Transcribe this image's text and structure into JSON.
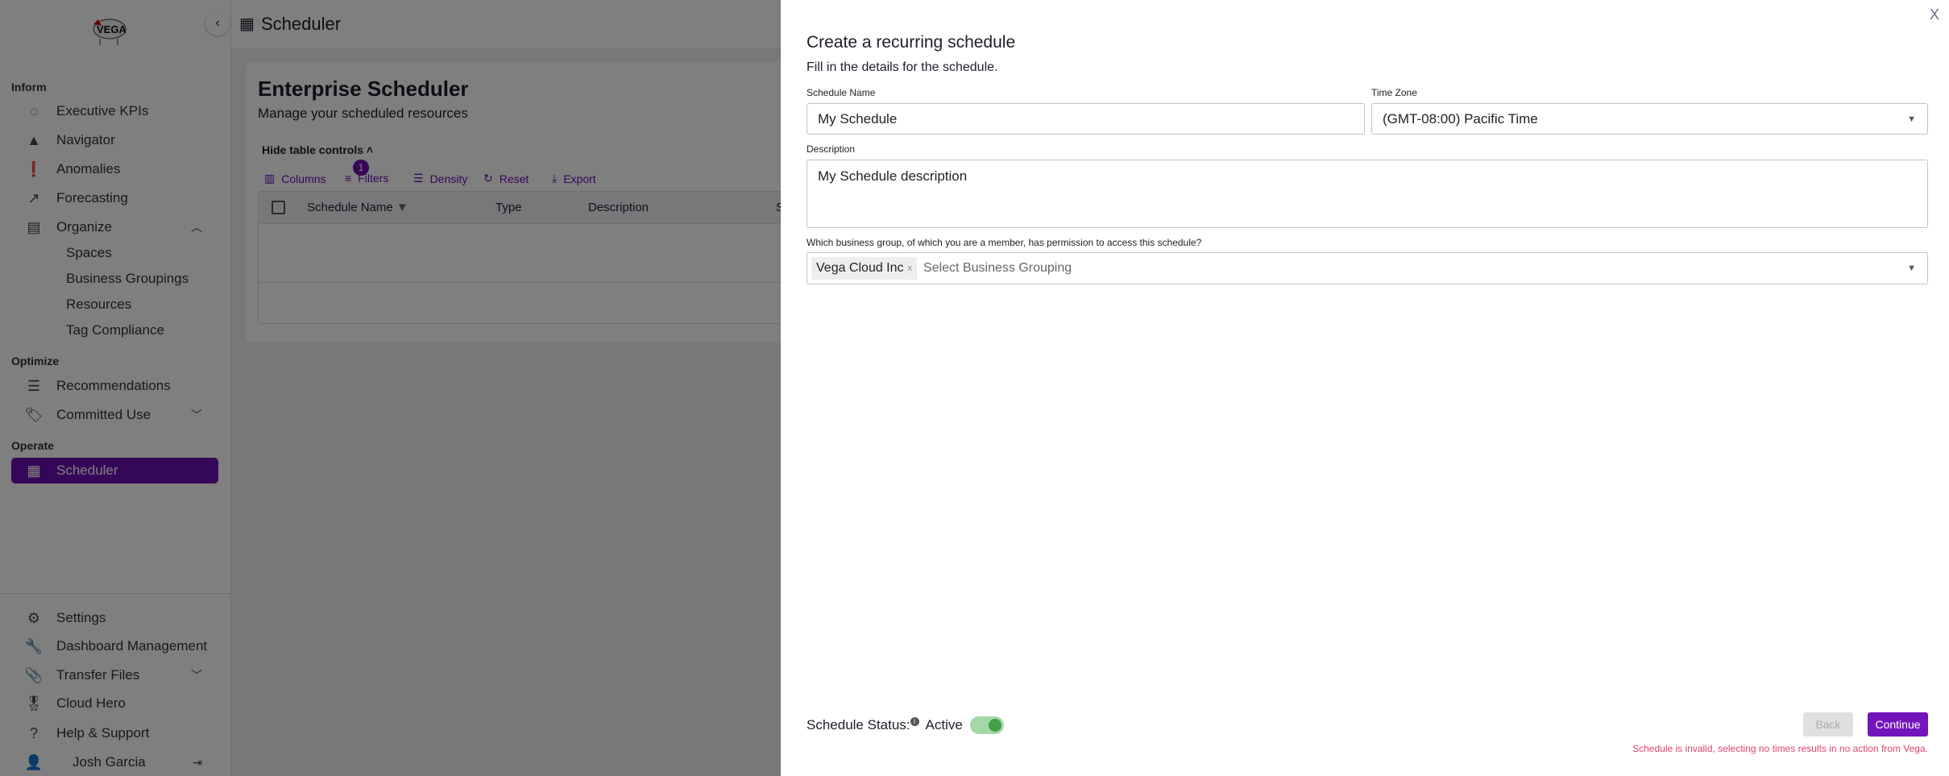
{
  "sidebar": {
    "sections": {
      "inform": "Inform",
      "optimize": "Optimize",
      "operate": "Operate"
    },
    "items": [
      {
        "label": "Executive KPIs",
        "icon": "circle-progress-icon"
      },
      {
        "label": "Navigator",
        "icon": "navigation-arrow-icon"
      },
      {
        "label": "Anomalies",
        "icon": "alert-circle-icon"
      },
      {
        "label": "Forecasting",
        "icon": "trending-up-icon"
      },
      {
        "label": "Organize",
        "icon": "archive-icon"
      }
    ],
    "organize_sub": [
      "Spaces",
      "Business Groupings",
      "Resources",
      "Tag Compliance"
    ],
    "optimize_items": [
      {
        "label": "Recommendations",
        "icon": "list-icon"
      },
      {
        "label": "Committed Use",
        "icon": "tag-icon"
      }
    ],
    "operate_items": [
      {
        "label": "Scheduler",
        "icon": "calendar-icon",
        "active": true
      }
    ],
    "bottom_items": [
      {
        "label": "Settings",
        "icon": "gear-icon"
      },
      {
        "label": "Dashboard Management",
        "icon": "wrench-icon"
      },
      {
        "label": "Transfer Files",
        "icon": "paperclip-file-icon"
      },
      {
        "label": "Cloud Hero",
        "icon": "medal-icon"
      },
      {
        "label": "Help & Support",
        "icon": "help-icon"
      }
    ],
    "user": "Josh Garcia"
  },
  "header": {
    "title": "Scheduler"
  },
  "page": {
    "title": "Enterprise Scheduler",
    "subtitle": "Manage your scheduled resources",
    "hide_controls": "Hide table controls",
    "toolbar": {
      "columns": "Columns",
      "filters": "Filters",
      "filter_count": "1",
      "density": "Density",
      "reset": "Reset",
      "export": "Export"
    },
    "columns": [
      "Schedule Name",
      "Type",
      "Description",
      "S"
    ]
  },
  "dialog": {
    "title": "Create a recurring schedule",
    "subtitle": "Fill in the details for the schedule.",
    "schedule_name_label": "Schedule Name",
    "schedule_name_value": "My Schedule",
    "time_zone_label": "Time Zone",
    "time_zone_value": "(GMT-08:00) Pacific Time",
    "description_label": "Description",
    "description_value": "My Schedule description",
    "group_label": "Which business group, of which you are a member, has permission to access this schedule?",
    "group_chip": "Vega Cloud Inc",
    "group_placeholder": "Select Business Grouping",
    "status_label": "Schedule Status:",
    "status_value": "Active",
    "status_on": true,
    "back": "Back",
    "continue": "Continue",
    "error": "Schedule is invalid, selecting no times results in no action from Vega.",
    "close": "X"
  },
  "colors": {
    "accent": "#6a0fb3",
    "toggle": "#43a047",
    "error": "#e0436b"
  }
}
